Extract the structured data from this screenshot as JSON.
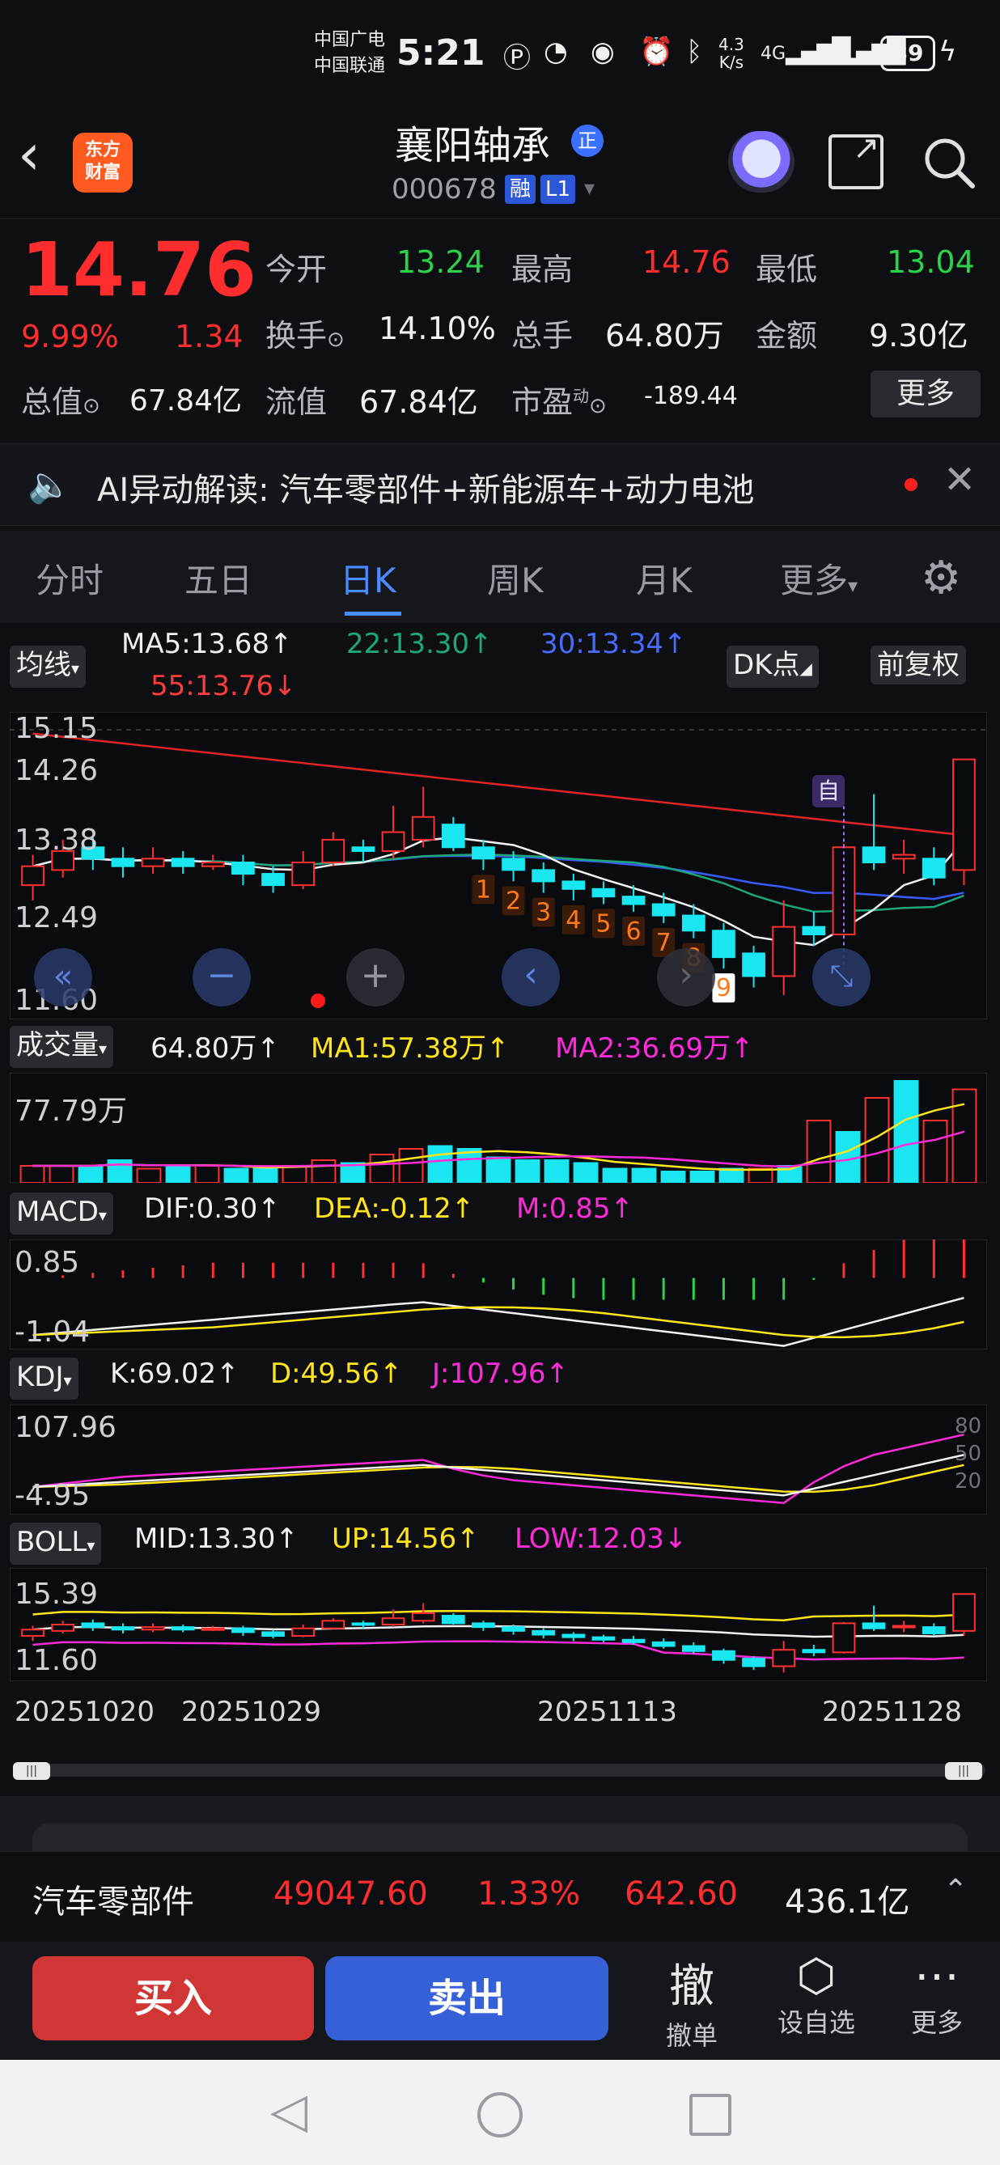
{
  "status_bar": {
    "carrier1": "中国广电",
    "carrier2": "中国联通",
    "time": "5:21",
    "speed_top": "4.3",
    "speed_unit": "K/s",
    "net1": "4G",
    "net2": "4G",
    "battery": "89"
  },
  "header": {
    "logo_line1": "东方",
    "logo_line2": "财富",
    "stock_name": "襄阳轴承",
    "stock_badge": "正",
    "stock_code": "000678",
    "tag_rong": "融",
    "tag_level": "L1"
  },
  "quote": {
    "price": "14.76",
    "change_pct": "9.99%",
    "change_amt": "1.34",
    "rows": [
      [
        {
          "label": "今开",
          "value": "13.24",
          "color": "green"
        },
        {
          "label": "最高",
          "value": "14.76",
          "color": "red"
        },
        {
          "label": "最低",
          "value": "13.04",
          "color": "green"
        }
      ],
      [
        {
          "label": "换手",
          "value": "14.10%",
          "color": "white"
        },
        {
          "label": "总手",
          "value": "64.80万",
          "color": "white"
        },
        {
          "label": "金额",
          "value": "9.30亿",
          "color": "white"
        }
      ]
    ],
    "total_value_label": "总值",
    "total_value": "67.84亿",
    "float_value_label": "流值",
    "float_value": "67.84亿",
    "pe_label": "市盈",
    "pe_sup": "动",
    "pe_value": "-189.44",
    "more_button": "更多"
  },
  "ai_bar": {
    "text": "AI异动解读:  汽车零部件+新能源车+动力电池"
  },
  "tabs": [
    "分时",
    "五日",
    "日K",
    "周K",
    "月K",
    "更多"
  ],
  "active_tab": 2,
  "kline": {
    "ma_button": "均线",
    "ma5": "MA5:13.68↑",
    "ma22": "22:13.30↑",
    "ma30": "30:13.34↑",
    "ma55": "55:13.76↓",
    "dk_button": "DK点",
    "fq_button": "前复权",
    "axis_labels": [
      "15.15",
      "14.26",
      "13.38",
      "12.49",
      "11.60"
    ],
    "zi_label": "自",
    "td_counts": [
      "1",
      "2",
      "3",
      "4",
      "5",
      "6",
      "7",
      "8",
      "9"
    ],
    "candles": [
      {
        "o": 13.1,
        "c": 13.35,
        "h": 13.5,
        "l": 12.9
      },
      {
        "o": 13.3,
        "c": 13.55,
        "h": 13.7,
        "l": 13.2
      },
      {
        "o": 13.6,
        "c": 13.45,
        "h": 13.75,
        "l": 13.3
      },
      {
        "o": 13.45,
        "c": 13.35,
        "h": 13.6,
        "l": 13.2
      },
      {
        "o": 13.35,
        "c": 13.45,
        "h": 13.6,
        "l": 13.25
      },
      {
        "o": 13.45,
        "c": 13.35,
        "h": 13.55,
        "l": 13.25
      },
      {
        "o": 13.35,
        "c": 13.4,
        "h": 13.5,
        "l": 13.3
      },
      {
        "o": 13.4,
        "c": 13.25,
        "h": 13.5,
        "l": 13.1
      },
      {
        "o": 13.25,
        "c": 13.1,
        "h": 13.35,
        "l": 13.0
      },
      {
        "o": 13.1,
        "c": 13.4,
        "h": 13.55,
        "l": 13.05
      },
      {
        "o": 13.4,
        "c": 13.7,
        "h": 13.8,
        "l": 13.35
      },
      {
        "o": 13.6,
        "c": 13.55,
        "h": 13.7,
        "l": 13.4
      },
      {
        "o": 13.55,
        "c": 13.8,
        "h": 14.15,
        "l": 13.45
      },
      {
        "o": 13.7,
        "c": 14.0,
        "h": 14.4,
        "l": 13.6
      },
      {
        "o": 13.9,
        "c": 13.6,
        "h": 14.0,
        "l": 13.55
      },
      {
        "o": 13.6,
        "c": 13.45,
        "h": 13.7,
        "l": 13.3
      },
      {
        "o": 13.45,
        "c": 13.3,
        "h": 13.55,
        "l": 13.15
      },
      {
        "o": 13.3,
        "c": 13.15,
        "h": 13.4,
        "l": 13.0
      },
      {
        "o": 13.15,
        "c": 13.05,
        "h": 13.25,
        "l": 12.9
      },
      {
        "o": 13.05,
        "c": 12.95,
        "h": 13.15,
        "l": 12.85
      },
      {
        "o": 12.95,
        "c": 12.85,
        "h": 13.1,
        "l": 12.75
      },
      {
        "o": 12.85,
        "c": 12.7,
        "h": 13.0,
        "l": 12.6
      },
      {
        "o": 12.7,
        "c": 12.5,
        "h": 12.85,
        "l": 12.4
      },
      {
        "o": 12.5,
        "c": 12.15,
        "h": 12.6,
        "l": 12.0
      },
      {
        "o": 12.2,
        "c": 11.9,
        "h": 12.3,
        "l": 11.75
      },
      {
        "o": 11.9,
        "c": 12.55,
        "h": 12.9,
        "l": 11.65
      },
      {
        "o": 12.55,
        "c": 12.45,
        "h": 12.75,
        "l": 12.3
      },
      {
        "o": 12.45,
        "c": 13.6,
        "h": 13.65,
        "l": 12.4
      },
      {
        "o": 13.6,
        "c": 13.4,
        "h": 14.3,
        "l": 13.3
      },
      {
        "o": 13.45,
        "c": 13.5,
        "h": 13.7,
        "l": 13.25
      },
      {
        "o": 13.45,
        "c": 13.2,
        "h": 13.6,
        "l": 13.1
      },
      {
        "o": 13.3,
        "c": 14.76,
        "h": 14.76,
        "l": 13.1
      }
    ]
  },
  "zoom_icons": [
    "rewind-icon",
    "minus-icon",
    "plus-icon",
    "left-icon",
    "right-icon",
    "expand-icon"
  ],
  "volume": {
    "button": "成交量",
    "current": "64.80万↑",
    "ma1": "MA1:57.38万↑",
    "ma2": "MA2:36.69万↑",
    "axis_top": "77.79万",
    "bars": [
      6,
      6,
      6,
      8,
      5,
      6,
      6,
      5,
      5,
      6,
      8,
      7,
      10,
      12,
      13,
      12,
      9,
      8,
      8,
      7,
      5,
      5,
      4,
      4,
      5,
      5,
      6,
      22,
      18,
      30,
      36,
      22,
      33
    ]
  },
  "macd": {
    "button": "MACD",
    "dif": "DIF:0.30↑",
    "dea": "DEA:-0.12↑",
    "m": "M:0.85↑",
    "axis_top": "0.85",
    "axis_bottom": "-1.04"
  },
  "kdj": {
    "button": "KDJ",
    "k": "K:69.02↑",
    "d": "D:49.56↑",
    "j": "J:107.96↑",
    "axis_top": "107.96",
    "axis_bottom": "-4.95",
    "right_labels": [
      "80",
      "50",
      "20"
    ]
  },
  "boll": {
    "button": "BOLL",
    "mid": "MID:13.30↑",
    "up": "UP:14.56↑",
    "low": "LOW:12.03↓",
    "axis_top": "15.39",
    "axis_bottom": "11.60"
  },
  "dates": [
    "20251020",
    "20251029",
    "20251113",
    "20251128"
  ],
  "sector": {
    "name": "汽车零部件",
    "index": "49047.60",
    "pct": "1.33%",
    "change": "642.60",
    "amount": "436.1亿"
  },
  "bottom_bar": {
    "buy": "买入",
    "sell": "卖出",
    "cancel_icon": "撤",
    "cancel": "撤单",
    "watch": "设自选",
    "more": "更多"
  }
}
